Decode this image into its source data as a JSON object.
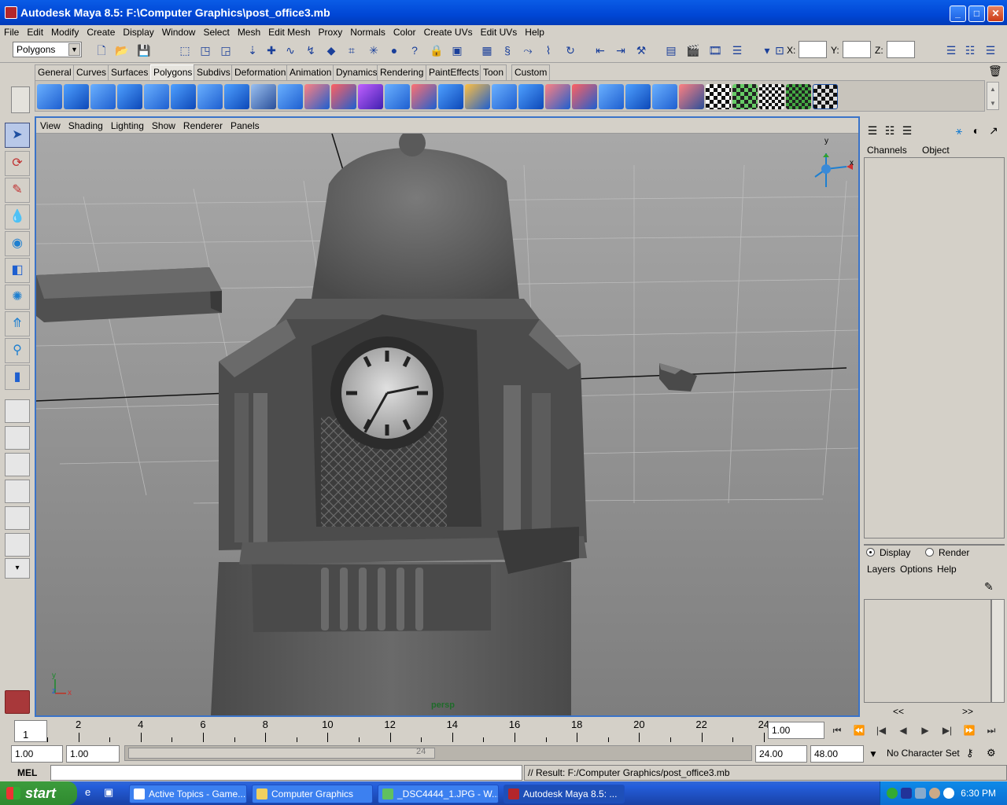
{
  "window": {
    "title": "Autodesk Maya 8.5: F:\\Computer Graphics\\post_office3.mb",
    "min_glyph": "_",
    "max_glyph": "□",
    "close_glyph": "✕"
  },
  "menu": [
    "File",
    "Edit",
    "Modify",
    "Create",
    "Display",
    "Window",
    "Select",
    "Mesh",
    "Edit Mesh",
    "Proxy",
    "Normals",
    "Color",
    "Create UVs",
    "Edit UVs",
    "Help"
  ],
  "status": {
    "mode": "Polygons",
    "x_label": "X:",
    "y_label": "Y:",
    "z_label": "Z:"
  },
  "shelf_tabs": [
    "General",
    "Curves",
    "Surfaces",
    "Polygons",
    "Subdivs",
    "Deformation",
    "Animation",
    "Dynamics",
    "Rendering",
    "PaintEffects",
    "Toon",
    "Custom"
  ],
  "active_shelf": "Polygons",
  "viewport": {
    "menu": [
      "View",
      "Shading",
      "Lighting",
      "Show",
      "Renderer",
      "Panels"
    ],
    "camera": "persp",
    "axis_y": "y",
    "axis_x": "x",
    "axis_z": "z"
  },
  "channel_box": {
    "tabs": [
      "Channels",
      "Object"
    ]
  },
  "layer_editor": {
    "display": "Display",
    "render": "Render",
    "menu": [
      "Layers",
      "Options",
      "Help"
    ],
    "scroll_left": "<<",
    "scroll_right": ">>"
  },
  "timeline": {
    "current_frame": "1",
    "labels": [
      "2",
      "4",
      "6",
      "8",
      "10",
      "12",
      "14",
      "16",
      "18",
      "20",
      "22",
      "24"
    ],
    "frame_field": "1.00"
  },
  "range": {
    "start": "1.00",
    "playback_start": "1.00",
    "playback_end": "24.00",
    "end": "48.00",
    "slider_label": "24",
    "character_set": "No Character Set"
  },
  "command": {
    "label": "MEL",
    "result": "// Result: F:/Computer Graphics/post_office3.mb"
  },
  "taskbar": {
    "start": "start",
    "tasks": [
      "Active Topics - Game...",
      "Computer Graphics",
      "_DSC4444_1.JPG - W...",
      "Autodesk Maya 8.5: ..."
    ],
    "clock": "6:30 PM"
  }
}
